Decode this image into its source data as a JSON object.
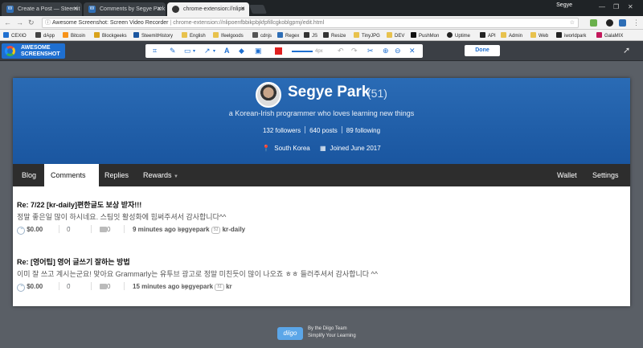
{
  "browser": {
    "tabs": [
      {
        "title": "Create a Post — Steemit"
      },
      {
        "title": "Comments by Segye Park"
      },
      {
        "title": "chrome-extension://nlipo"
      }
    ],
    "user": "Segye",
    "url_prefix": "Awesome Screenshot: Screen Video Recorder",
    "url": "chrome-extension://nlipoenfbbikpbjkfpfillcgkoblgpmj/edit.html",
    "bookmarks": [
      "CEXIO",
      "dApp",
      "Bitcoin",
      "Blockgeeks",
      "SteemitHistory",
      "English",
      "Ifeelgoods",
      "cdnjs",
      "Regex",
      "JS",
      "Resize",
      "TinyJPG",
      "DEV",
      "PushMon",
      "Uptime",
      "API",
      "Admin",
      "Web",
      "iworldpark",
      "GalaMIX"
    ]
  },
  "toolbar": {
    "logo_line1": "AWESOME",
    "logo_line2": "SCREENSHOT",
    "line_width_label": "4px",
    "done_label": "Done",
    "accent_color": "#1e6fd0",
    "swatch_color": "#e02020"
  },
  "profile": {
    "name": "Segye Park",
    "reputation": "(51)",
    "tagline": "a Korean-Irish programmer who loves learning new things",
    "followers": "132 followers",
    "posts": "640 posts",
    "following": "89 following",
    "location": "South Korea",
    "joined": "Joined June 2017"
  },
  "nav": {
    "blog": "Blog",
    "comments": "Comments",
    "replies": "Replies",
    "rewards": "Rewards",
    "wallet": "Wallet",
    "settings": "Settings"
  },
  "posts": [
    {
      "title": "Re: 7/22 [kr-daily]편한글도 보상 받자!!!",
      "body": "정말 좋은일 많이 하시네요. 스팀잇 활성화에 힘써주셔서 감사합니다^^",
      "payout": "$0.00",
      "votes": "0",
      "comments": "0",
      "time": "9 minutes ago",
      "by": "by",
      "author": "segyepark",
      "rep": "51",
      "in": "in",
      "category": "kr-daily"
    },
    {
      "title": "Re: [영어팁] 영어 글쓰기 잘하는 방법",
      "body": "이미 잘 쓰고 계시는군요! 맞아요 Grammarly는 유투브 광고로 정말 미친듯이 많이 나오죠 ㅎㅎ 들러주셔서 감사합니다 ^^",
      "payout": "$0.00",
      "votes": "0",
      "comments": "0",
      "time": "15 minutes ago",
      "by": "by",
      "author": "segyepark",
      "rep": "51",
      "in": "in",
      "category": "kr"
    }
  ],
  "footer": {
    "logo": "diigo",
    "line1": "By the Diigo Team",
    "line2": "Simplify Your Learning"
  }
}
